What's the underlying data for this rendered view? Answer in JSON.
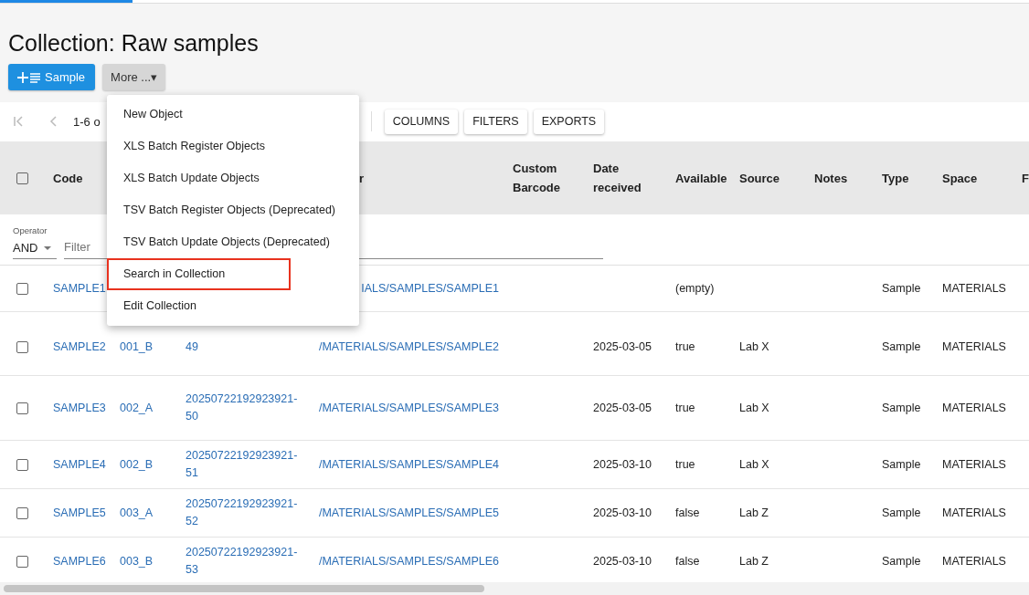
{
  "title": "Collection: Raw samples",
  "actions": {
    "add_button": "Sample",
    "more_button": "More ...▾"
  },
  "menu": {
    "items": [
      {
        "label": "New Object",
        "outlined": false
      },
      {
        "label": "XLS Batch Register Objects",
        "outlined": false
      },
      {
        "label": "XLS Batch Update Objects",
        "outlined": false
      },
      {
        "label": "TSV Batch Register Objects (Deprecated)",
        "outlined": false
      },
      {
        "label": "TSV Batch Update Objects (Deprecated)",
        "outlined": false
      },
      {
        "label": "Search in Collection",
        "outlined": true
      },
      {
        "label": "Edit Collection",
        "outlined": false
      }
    ]
  },
  "pagination": {
    "range": "1-6 o"
  },
  "toolbar": [
    "COLUMNS",
    "FILTERS",
    "EXPORTS"
  ],
  "table": {
    "select_all": {
      "checked": false
    },
    "columns": [
      "Code",
      "",
      "",
      "r",
      "Custom Barcode",
      "Date received",
      "Available",
      "Source",
      "Notes",
      "Type",
      "Space",
      "F"
    ],
    "filter": {
      "operator_label": "Operator",
      "operator": "AND",
      "placeholder": "Filter"
    },
    "rows": [
      {
        "checked": false,
        "cells": [
          "SAMPLE1",
          "",
          "",
          "IALS/SAMPLES/SAMPLE1",
          "",
          "",
          "(empty)",
          "",
          "",
          "Sample",
          "MATERIALS"
        ]
      },
      {
        "checked": false,
        "cells": [
          "SAMPLE2",
          "001_B",
          "49",
          "/MATERIALS/SAMPLES/SAMPLE2",
          "",
          "2025-03-05",
          "true",
          "Lab X",
          "",
          "Sample",
          "MATERIALS"
        ]
      },
      {
        "checked": false,
        "cells": [
          "SAMPLE3",
          "002_A",
          "20250722192923921-50",
          "/MATERIALS/SAMPLES/SAMPLE3",
          "",
          "2025-03-05",
          "true",
          "Lab X",
          "",
          "Sample",
          "MATERIALS"
        ]
      },
      {
        "checked": false,
        "cells": [
          "SAMPLE4",
          "002_B",
          "20250722192923921-51",
          "/MATERIALS/SAMPLES/SAMPLE4",
          "",
          "2025-03-10",
          "true",
          "Lab X",
          "",
          "Sample",
          "MATERIALS"
        ]
      },
      {
        "checked": false,
        "cells": [
          "SAMPLE5",
          "003_A",
          "20250722192923921-52",
          "/MATERIALS/SAMPLES/SAMPLE5",
          "",
          "2025-03-10",
          "false",
          "Lab Z",
          "",
          "Sample",
          "MATERIALS"
        ]
      },
      {
        "checked": false,
        "cells": [
          "SAMPLE6",
          "003_B",
          "20250722192923921-53",
          "/MATERIALS/SAMPLES/SAMPLE6",
          "",
          "2025-03-10",
          "false",
          "Lab Z",
          "",
          "Sample",
          "MATERIALS"
        ]
      }
    ]
  }
}
